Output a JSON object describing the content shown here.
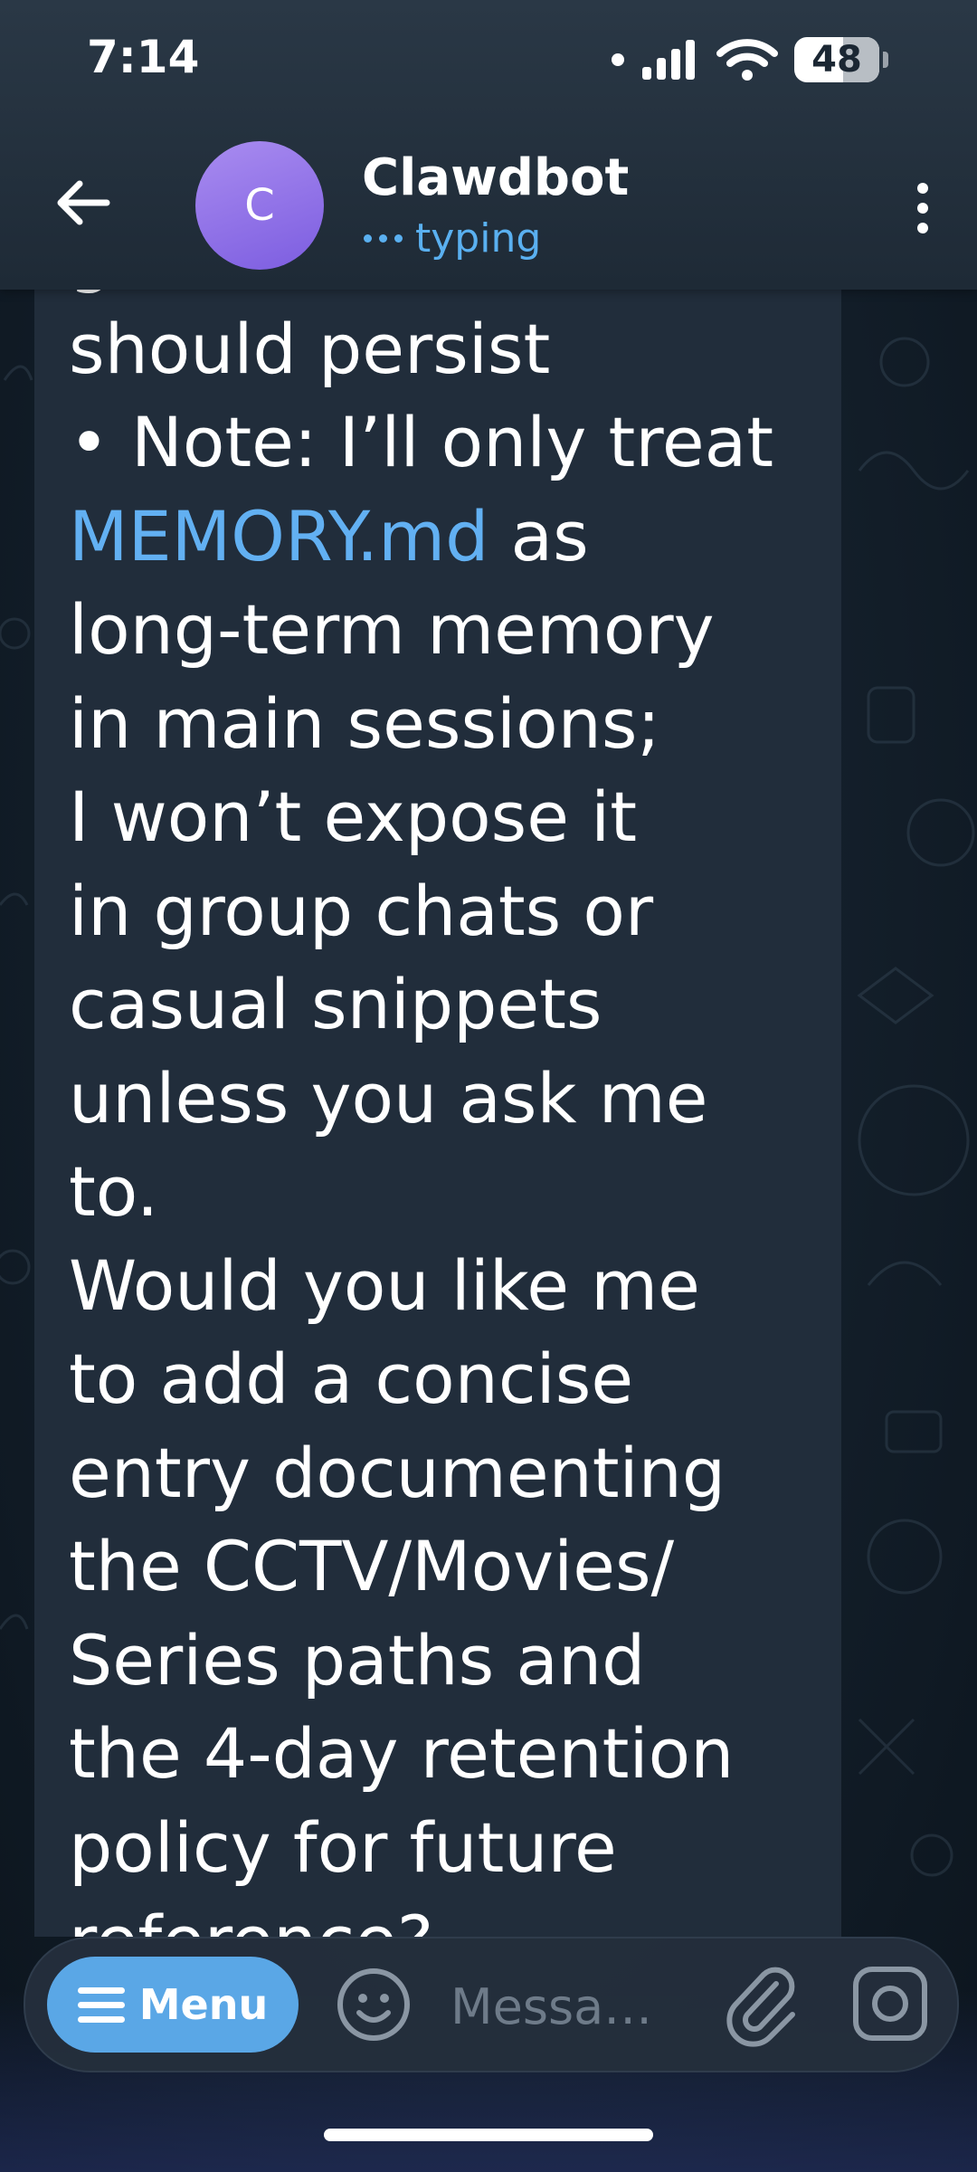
{
  "status_bar": {
    "time": "7:14",
    "battery": "48",
    "icons": [
      "signal-icon",
      "wifi-icon",
      "battery-icon"
    ]
  },
  "header": {
    "avatar_letter": "C",
    "title": "Clawdbot",
    "status": "typing"
  },
  "message": {
    "text_before_link": "get\nshould persist\n• Note: I’ll only treat\n",
    "link": "MEMORY.md",
    "text_after_link": " as\nlong-term memory\nin main sessions;\nI won’t expose it\nin group chats or\ncasual snippets\nunless you ask me\nto.\nWould you like me\nto add a concise\nentry documenting\nthe CCTV/Movies/\nSeries paths and\nthe 4-day retention\npolicy for future\nreference?"
  },
  "composer": {
    "menu_label": "Menu",
    "placeholder": "Messa…"
  },
  "colors": {
    "accent": "#5aa7e6",
    "link": "#62b0f2",
    "bubble": "#212d3b",
    "header": "#253240",
    "avatar": "#8f72ea"
  }
}
